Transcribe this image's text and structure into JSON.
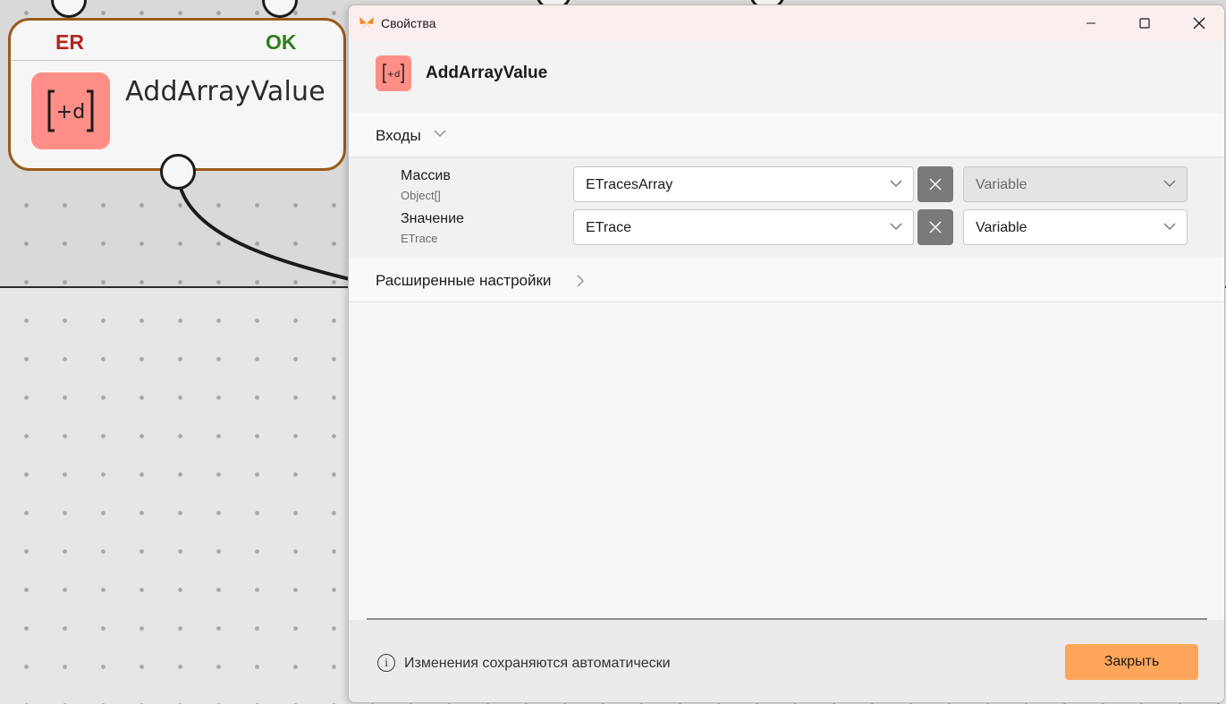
{
  "node": {
    "error_port_label": "ER",
    "ok_port_label": "OK",
    "icon_text": "[+d]",
    "title": "AddArrayValue"
  },
  "window": {
    "title": "Свойства",
    "app_icon": "butterfly-icon",
    "minimize_icon": "minimize-icon",
    "maximize_icon": "maximize-icon",
    "close_icon": "close-icon"
  },
  "header": {
    "icon_text": "[+d]",
    "title": "AddArrayValue"
  },
  "inputs_section": {
    "label": "Входы",
    "expanded": true,
    "params": [
      {
        "name": "Массив",
        "type": "Object[]",
        "value": "ETracesArray",
        "mode": "Variable",
        "mode_disabled": true
      },
      {
        "name": "Значение",
        "type": "ETrace",
        "value": "ETrace",
        "mode": "Variable",
        "mode_disabled": false
      }
    ]
  },
  "advanced_section": {
    "label": "Расширенные настройки",
    "expanded": false
  },
  "footer": {
    "info_text": "Изменения сохраняются автоматически",
    "close_button_label": "Закрыть"
  },
  "colors": {
    "accent": "#ffa65a",
    "node_icon_bg": "#ff8e86",
    "node_border": "#9a5b1a",
    "error_label": "#b3261e",
    "ok_label": "#2e7d1f"
  }
}
